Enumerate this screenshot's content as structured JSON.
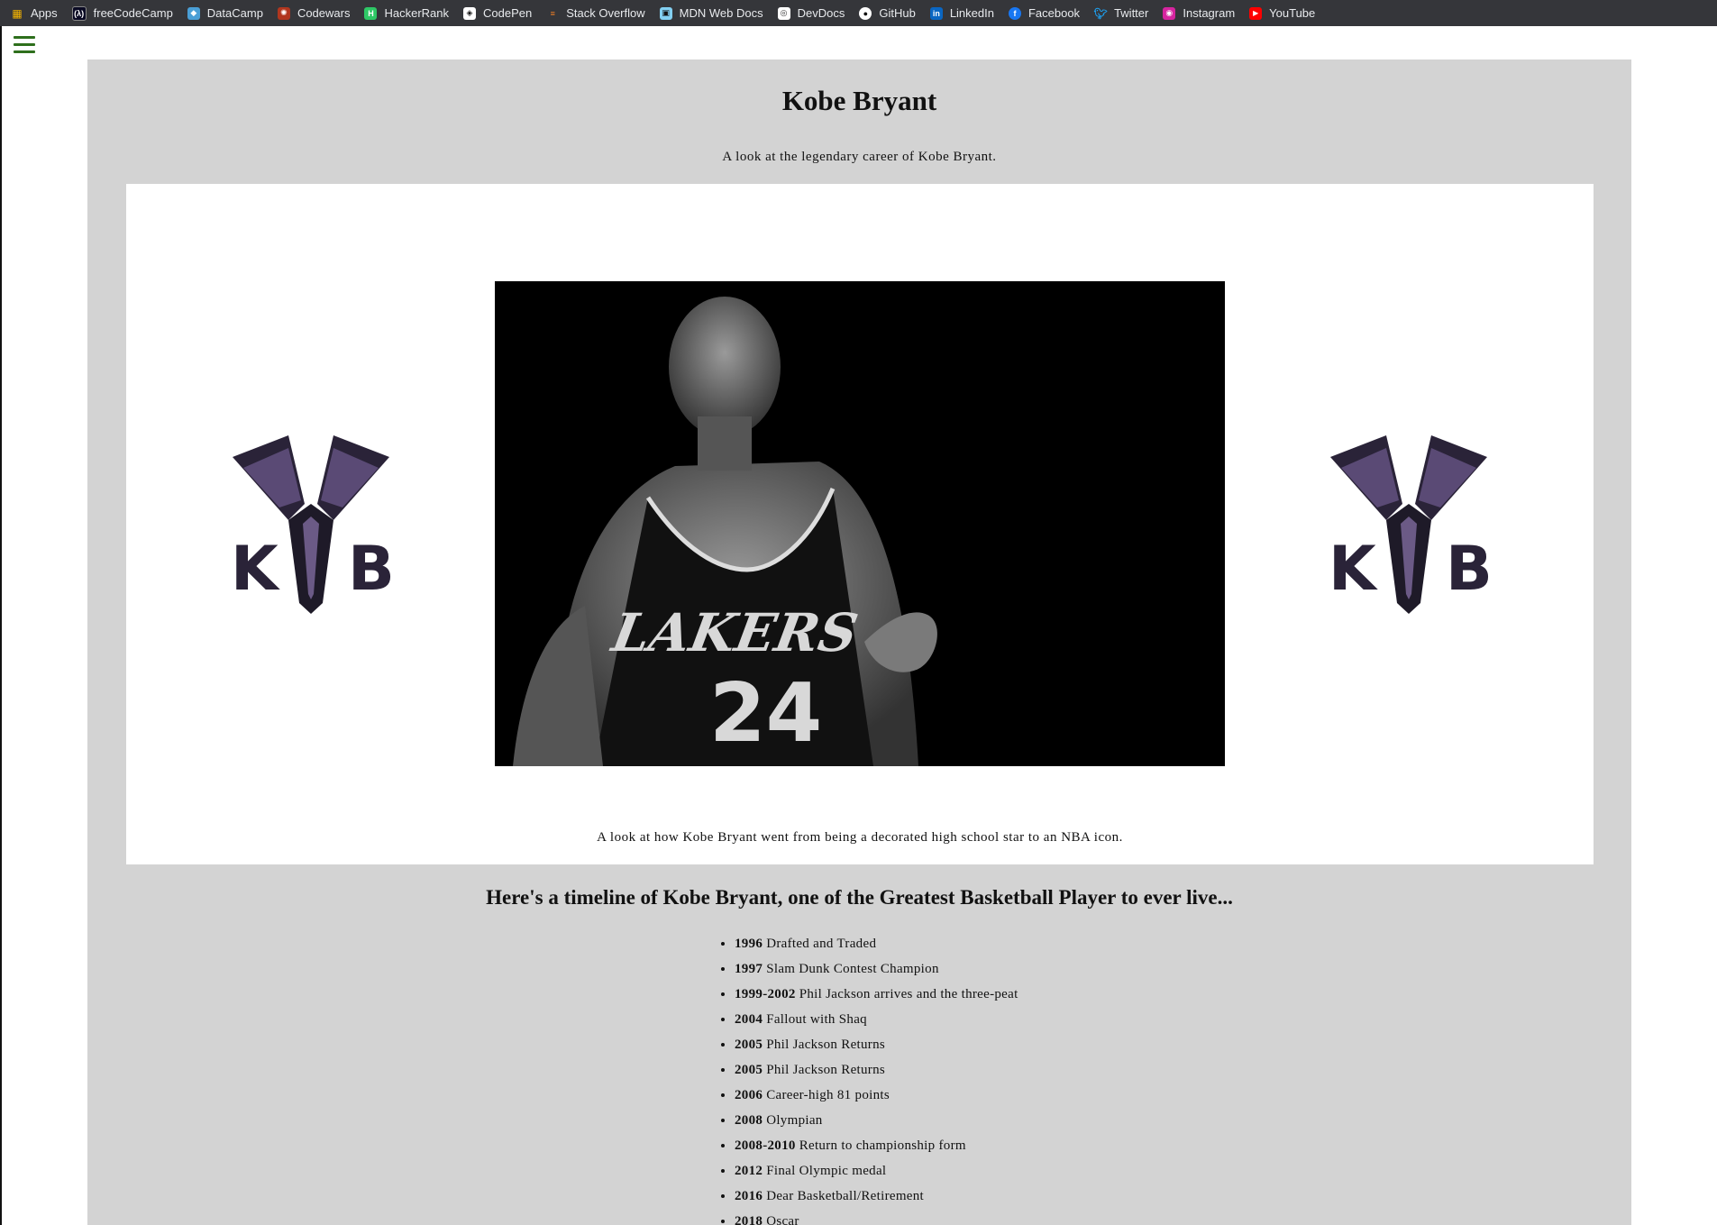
{
  "bookmarks": [
    {
      "label": "Apps",
      "icon": "apps-grid-icon",
      "color": "#f4b400"
    },
    {
      "label": "freeCodeCamp",
      "icon": "freecodecamp-icon",
      "color": "#0a0a23"
    },
    {
      "label": "DataCamp",
      "icon": "datacamp-icon",
      "color": "#4a9fd6"
    },
    {
      "label": "Codewars",
      "icon": "codewars-icon",
      "color": "#b1361e"
    },
    {
      "label": "HackerRank",
      "icon": "hackerrank-icon",
      "color": "#2ec866"
    },
    {
      "label": "CodePen",
      "icon": "codepen-icon",
      "color": "#111111"
    },
    {
      "label": "Stack Overflow",
      "icon": "stackoverflow-icon",
      "color": "#f48024"
    },
    {
      "label": "MDN Web Docs",
      "icon": "mdn-icon",
      "color": "#83d0f2"
    },
    {
      "label": "DevDocs",
      "icon": "devdocs-icon",
      "color": "#5e6771"
    },
    {
      "label": "GitHub",
      "icon": "github-icon",
      "color": "#ffffff"
    },
    {
      "label": "LinkedIn",
      "icon": "linkedin-icon",
      "color": "#0a66c2"
    },
    {
      "label": "Facebook",
      "icon": "facebook-icon",
      "color": "#1877f2"
    },
    {
      "label": "Twitter",
      "icon": "twitter-icon",
      "color": "#1da1f2"
    },
    {
      "label": "Instagram",
      "icon": "instagram-icon",
      "color": "#d6249f"
    },
    {
      "label": "YouTube",
      "icon": "youtube-icon",
      "color": "#ff0000"
    }
  ],
  "nav": {
    "menu_icon": "hamburger-menu-icon",
    "menu_color": "#2e6f1c"
  },
  "page": {
    "title": "Kobe Bryant",
    "subtitle": "A look at the legendary career of Kobe Bryant.",
    "panel_bg": "#d3d3d3"
  },
  "image_section": {
    "logo_text_left": "K",
    "logo_text_right": "B",
    "jersey_team": "LAKERS",
    "jersey_number": "24",
    "caption": "A look at how Kobe Bryant went from being a decorated high school star to an NBA icon."
  },
  "timeline": {
    "heading": "Here's a timeline of Kobe Bryant, one of the Greatest Basketball Player to ever live...",
    "items": [
      {
        "year": "1996",
        "event": "Drafted and Traded"
      },
      {
        "year": "1997",
        "event": "Slam Dunk Contest Champion"
      },
      {
        "year": "1999-2002",
        "event": "Phil Jackson arrives and the three-peat"
      },
      {
        "year": "2004",
        "event": "Fallout with Shaq"
      },
      {
        "year": "2005",
        "event": "Phil Jackson Returns"
      },
      {
        "year": "2005",
        "event": "Phil Jackson Returns"
      },
      {
        "year": "2006",
        "event": "Career-high 81 points"
      },
      {
        "year": "2008",
        "event": "Olympian"
      },
      {
        "year": "2008-2010",
        "event": "Return to championship form"
      },
      {
        "year": "2012",
        "event": "Final Olympic medal"
      },
      {
        "year": "2016",
        "event": "Dear Basketball/Retirement"
      },
      {
        "year": "2018",
        "event": "Oscar"
      }
    ]
  }
}
